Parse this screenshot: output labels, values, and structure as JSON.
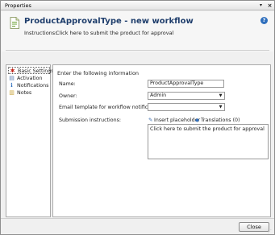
{
  "window": {
    "title": "Properties",
    "pin_glyph": "▾",
    "close_glyph": "×"
  },
  "header": {
    "title": "ProductApprovalType - new workflow",
    "instructions_label": "Instructions:",
    "instructions_link": "Click here to submit the product for approval",
    "help_glyph": "?"
  },
  "nav": {
    "items": [
      {
        "label": "Basic Settings",
        "icon": "red-star-icon",
        "glyph": "✱",
        "color": "#c0281e",
        "selected": true
      },
      {
        "label": "Activation",
        "icon": "activation-icon",
        "glyph": "▤",
        "color": "#5a7fb5",
        "selected": false
      },
      {
        "label": "Notifications",
        "icon": "info-icon",
        "glyph": "ℹ",
        "color": "#2f6fbd",
        "selected": false
      },
      {
        "label": "Notes",
        "icon": "notes-icon",
        "glyph": "▥",
        "color": "#c9a43a",
        "selected": false
      }
    ]
  },
  "form": {
    "intro": "Enter the following information",
    "name_label": "Name:",
    "name_value": "ProductApprovalType",
    "owner_label": "Owner:",
    "owner_value": "Admin",
    "email_label": "Email template for workflow notifications:",
    "email_value": "",
    "submission_label": "Submission instructions:",
    "insert_placeholder": "Insert placeholder",
    "translations": "Translations (0)",
    "submission_text": "Click here to submit the product for approval",
    "dropdown_glyph": "▼"
  },
  "footer": {
    "close_label": "Close",
    "grip_glyph": "⋰"
  },
  "colors": {
    "title_blue": "#1f3e6c",
    "help_blue": "#2f6fbd"
  }
}
